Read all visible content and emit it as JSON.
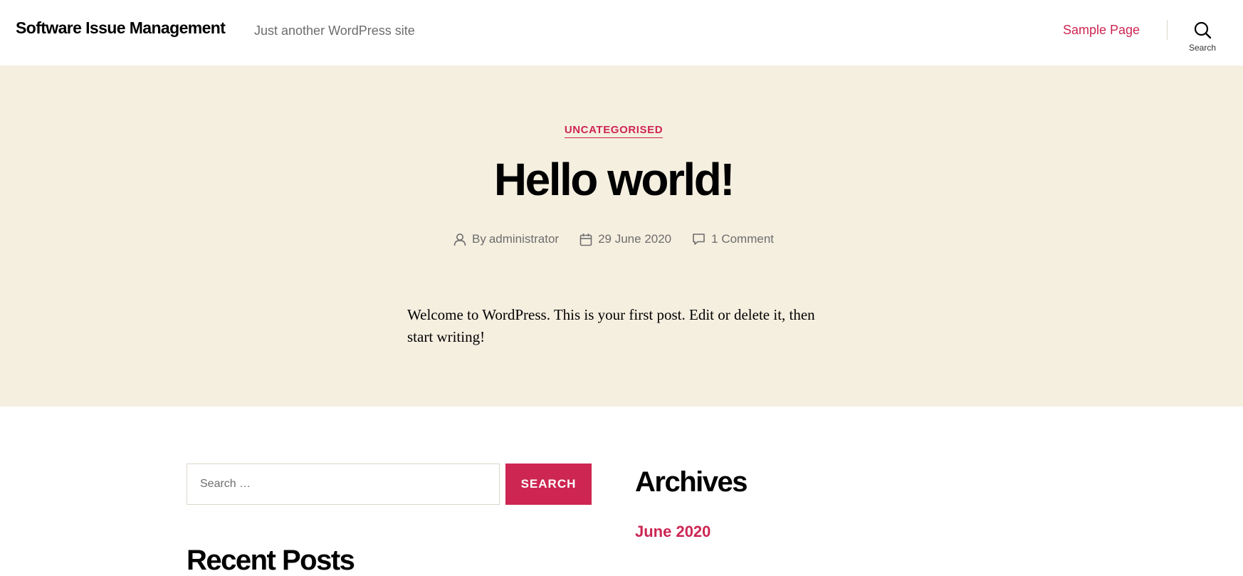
{
  "header": {
    "site_title": "Software Issue Management",
    "site_description": "Just another WordPress site",
    "nav_items": [
      {
        "label": "Sample Page"
      }
    ],
    "search_toggle_label": "Search"
  },
  "post": {
    "category": "Uncategorised",
    "title": "Hello world!",
    "meta": {
      "author_prefix": "By",
      "author": "administrator",
      "date": "29 June 2020",
      "comments": "1 Comment"
    },
    "content": "Welcome to WordPress. This is your first post. Edit or delete it, then start writing!"
  },
  "widgets": {
    "search": {
      "placeholder": "Search …",
      "button_label": "Search"
    },
    "recent_posts_title": "Recent Posts",
    "archives_title": "Archives",
    "archives": [
      {
        "label": "June 2020"
      }
    ]
  },
  "colors": {
    "accent": "#cd2653",
    "hero_background": "#f5efe0",
    "meta_text": "#6d6d6d"
  },
  "icons": [
    "search-icon",
    "user-icon",
    "calendar-icon",
    "comment-icon"
  ]
}
